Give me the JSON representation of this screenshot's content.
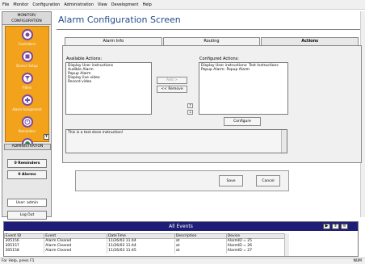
{
  "menu": [
    "File",
    "Monitor",
    "Configuration",
    "Administration",
    "View",
    "Development",
    "Help"
  ],
  "left_panel": {
    "header": "MONITOR/ CONFIGURATION",
    "nav_items": [
      {
        "label": "Controllers",
        "icon": "controller-icon"
      },
      {
        "label": "Device Setup",
        "icon": "device-setup-icon"
      },
      {
        "label": "Filters",
        "icon": "filter-icon"
      },
      {
        "label": "Alarm Assignment",
        "icon": "alarm-assignment-icon"
      },
      {
        "label": "Reminders",
        "icon": "reminder-icon"
      },
      {
        "label": "",
        "icon": "globe-icon"
      }
    ],
    "admin_label": "ADMINISTRATION",
    "reminders_button": "0 Reminders",
    "alarms_button": "0 Alarms",
    "user_label": "User: admin",
    "logout_button": "Log Out"
  },
  "main": {
    "title": "Alarm Configuration Screen",
    "tabs": [
      "Alarm Info",
      "Routing",
      "Actions"
    ],
    "active_tab": "Actions",
    "available_label": "Available Actions:",
    "available_actions": [
      "Display User instructions",
      "Audible Alarm",
      "Popup Alarm",
      "Display live video",
      "Record video"
    ],
    "configured_label": "Configured Actions:",
    "configured_actions": [
      "Display User instructions: Test Instructions",
      "Popup Alarm: Popup Alarm"
    ],
    "add_button": "Add >",
    "remove_button": "<< Remove",
    "up_button": "↑",
    "down_button": "↓",
    "configure_button": "Configure",
    "instructions_text": "This is a test store instruction!",
    "save_button": "Save",
    "cancel_button": "Cancel"
  },
  "events": {
    "title": "All Events",
    "columns": [
      "Event ID",
      "Event",
      "DateTime",
      "Description",
      "Device"
    ],
    "rows": [
      [
        "305156",
        "Alarm Cleared",
        "11/26/03 11:44",
        "at",
        "AlarmID = 25"
      ],
      [
        "305157",
        "Alarm Cleared",
        "11/26/03 11:44",
        "at",
        "AlarmID = 26"
      ],
      [
        "305158",
        "Alarm Cleared",
        "11/26/03 11:45",
        "at",
        "AlarmID = 27"
      ]
    ]
  },
  "status": {
    "left": "For Help, press F1",
    "right": "NUM"
  }
}
